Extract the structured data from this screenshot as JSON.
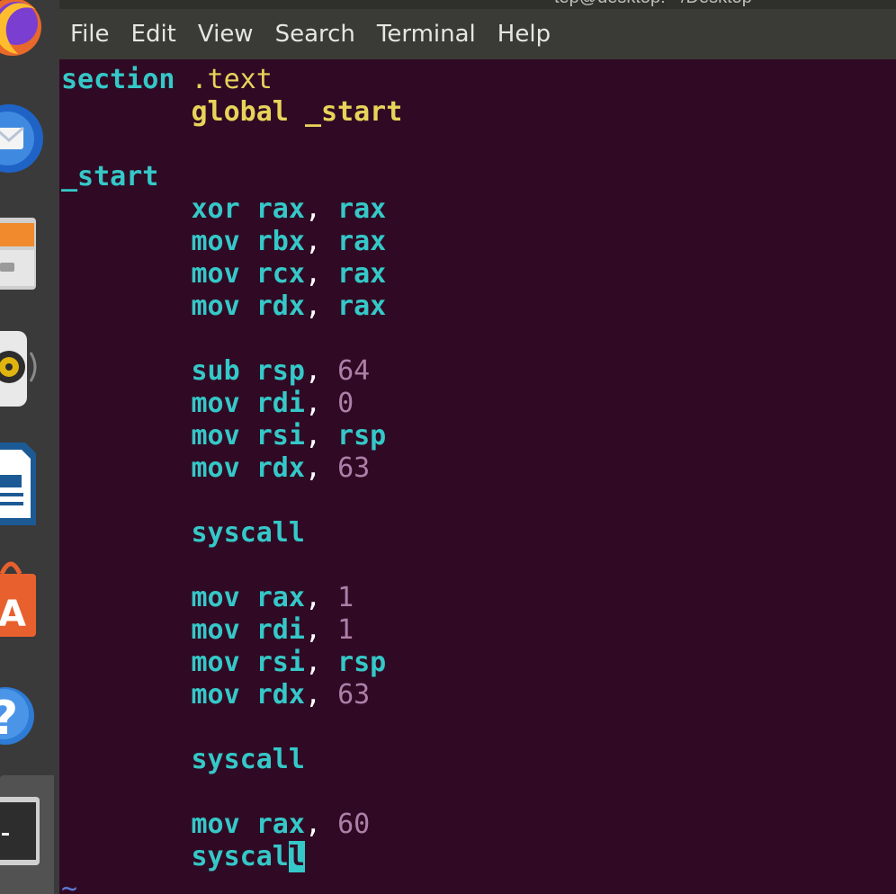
{
  "window": {
    "title": "tep@desktop: ~/Desktop"
  },
  "menu": [
    "File",
    "Edit",
    "View",
    "Search",
    "Terminal",
    "Help"
  ],
  "dock": {
    "items": [
      "firefox-icon",
      "thunderbird-icon",
      "files-icon",
      "rhythmbox-icon",
      "libreoffice-writer-icon",
      "software-center-icon",
      "help-icon",
      "terminal-icon"
    ]
  },
  "editor": {
    "lines": [
      [
        "section",
        " ",
        ".text"
      ],
      [
        "        ",
        "global",
        " ",
        "_start"
      ],
      [
        ""
      ],
      [
        "_start"
      ],
      [
        "        ",
        "xor",
        " ",
        "rax",
        ",",
        " ",
        "rax"
      ],
      [
        "        ",
        "mov",
        " ",
        "rbx",
        ",",
        " ",
        "rax"
      ],
      [
        "        ",
        "mov",
        " ",
        "rcx",
        ",",
        " ",
        "rax"
      ],
      [
        "        ",
        "mov",
        " ",
        "rdx",
        ",",
        " ",
        "rax"
      ],
      [
        ""
      ],
      [
        "        ",
        "sub",
        " ",
        "rsp",
        ",",
        " ",
        "64"
      ],
      [
        "        ",
        "mov",
        " ",
        "rdi",
        ",",
        " ",
        "0"
      ],
      [
        "        ",
        "mov",
        " ",
        "rsi",
        ",",
        " ",
        "rsp"
      ],
      [
        "        ",
        "mov",
        " ",
        "rdx",
        ",",
        " ",
        "63"
      ],
      [
        ""
      ],
      [
        "        ",
        "syscall"
      ],
      [
        ""
      ],
      [
        "        ",
        "mov",
        " ",
        "rax",
        ",",
        " ",
        "1"
      ],
      [
        "        ",
        "mov",
        " ",
        "rdi",
        ",",
        " ",
        "1"
      ],
      [
        "        ",
        "mov",
        " ",
        "rsi",
        ",",
        " ",
        "rsp"
      ],
      [
        "        ",
        "mov",
        " ",
        "rdx",
        ",",
        " ",
        "63"
      ],
      [
        ""
      ],
      [
        "        ",
        "syscall"
      ],
      [
        ""
      ],
      [
        "        ",
        "mov",
        " ",
        "rax",
        ",",
        " ",
        "60"
      ],
      [
        "        ",
        "syscal",
        "l"
      ],
      [
        "~"
      ]
    ],
    "cursor_char": "l",
    "empty_line_marker": "~"
  },
  "colors": {
    "background": "#300a24",
    "keyword": "#35c8c8",
    "directive": "#e8d35a",
    "number": "#ad7fa8",
    "menubar": "#3a3a36"
  }
}
